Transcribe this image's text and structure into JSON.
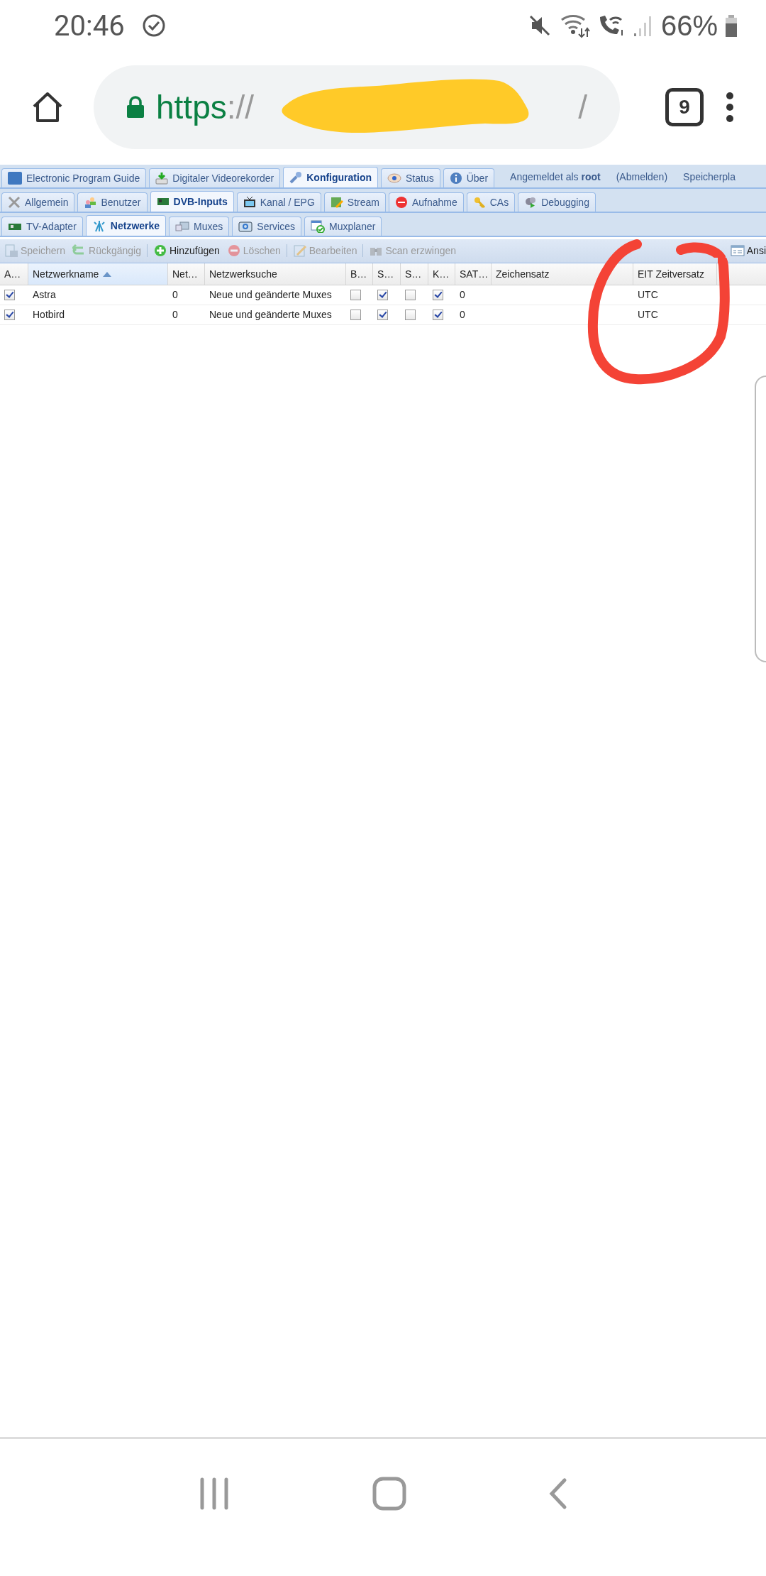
{
  "status_bar": {
    "time": "20:46",
    "battery": "66%"
  },
  "browser": {
    "scheme": "https",
    "separator": "://",
    "url_tail": "/",
    "tab_count": "9"
  },
  "main_tabs": [
    {
      "label": "Electronic Program Guide",
      "selected": false
    },
    {
      "label": "Digitaler Videorekorder",
      "selected": false
    },
    {
      "label": "Konfiguration",
      "selected": true
    },
    {
      "label": "Status",
      "selected": false
    },
    {
      "label": "Über",
      "selected": false
    }
  ],
  "session": {
    "login": "Angemeldet als **root**",
    "logout": "(Abmelden)",
    "storage": "Speicherpla"
  },
  "config_tabs": [
    {
      "label": "Allgemein",
      "selected": false
    },
    {
      "label": "Benutzer",
      "selected": false
    },
    {
      "label": "DVB-Inputs",
      "selected": true
    },
    {
      "label": "Kanal / EPG",
      "selected": false
    },
    {
      "label": "Stream",
      "selected": false
    },
    {
      "label": "Aufnahme",
      "selected": false
    },
    {
      "label": "CAs",
      "selected": false
    },
    {
      "label": "Debugging",
      "selected": false
    }
  ],
  "dvb_tabs": [
    {
      "label": "TV-Adapter",
      "selected": false
    },
    {
      "label": "Netzwerke",
      "selected": true
    },
    {
      "label": "Muxes",
      "selected": false
    },
    {
      "label": "Services",
      "selected": false
    },
    {
      "label": "Muxplaner",
      "selected": false
    }
  ],
  "toolbar": [
    {
      "label": "Speichern",
      "disabled": true
    },
    {
      "label": "Rückgängig",
      "disabled": true
    },
    {
      "label": "Hinzufügen",
      "disabled": false
    },
    {
      "label": "Löschen",
      "disabled": true
    },
    {
      "label": "Bearbeiten",
      "disabled": true
    },
    {
      "label": "Scan erzwingen",
      "disabled": true
    }
  ],
  "view_button": "Ansi",
  "table": {
    "columns": [
      {
        "label": "A…",
        "sorted": false
      },
      {
        "label": "Netzwerkname",
        "sorted": true
      },
      {
        "label": "Net…",
        "sorted": false
      },
      {
        "label": "Netzwerksuche",
        "sorted": false
      },
      {
        "label": "B…",
        "sorted": false
      },
      {
        "label": "S…",
        "sorted": false
      },
      {
        "label": "S…",
        "sorted": false
      },
      {
        "label": "K…",
        "sorted": false
      },
      {
        "label": "SAT…",
        "sorted": false
      },
      {
        "label": "Zeichensatz",
        "sorted": false
      },
      {
        "label": "EIT Zeitversatz",
        "sorted": false
      }
    ],
    "rows": [
      {
        "enabled": true,
        "name": "Astra",
        "network_id": "0",
        "scan": "Neue und geänderte Muxes",
        "flag_b": false,
        "flag_s1": true,
        "flag_s2": false,
        "flag_k": true,
        "sat": "0",
        "charset": "",
        "eit_offset": "UTC"
      },
      {
        "enabled": true,
        "name": "Hotbird",
        "network_id": "0",
        "scan": "Neue und geänderte Muxes",
        "flag_b": false,
        "flag_s1": true,
        "flag_s2": false,
        "flag_k": true,
        "sat": "0",
        "charset": "",
        "eit_offset": "UTC"
      }
    ]
  }
}
